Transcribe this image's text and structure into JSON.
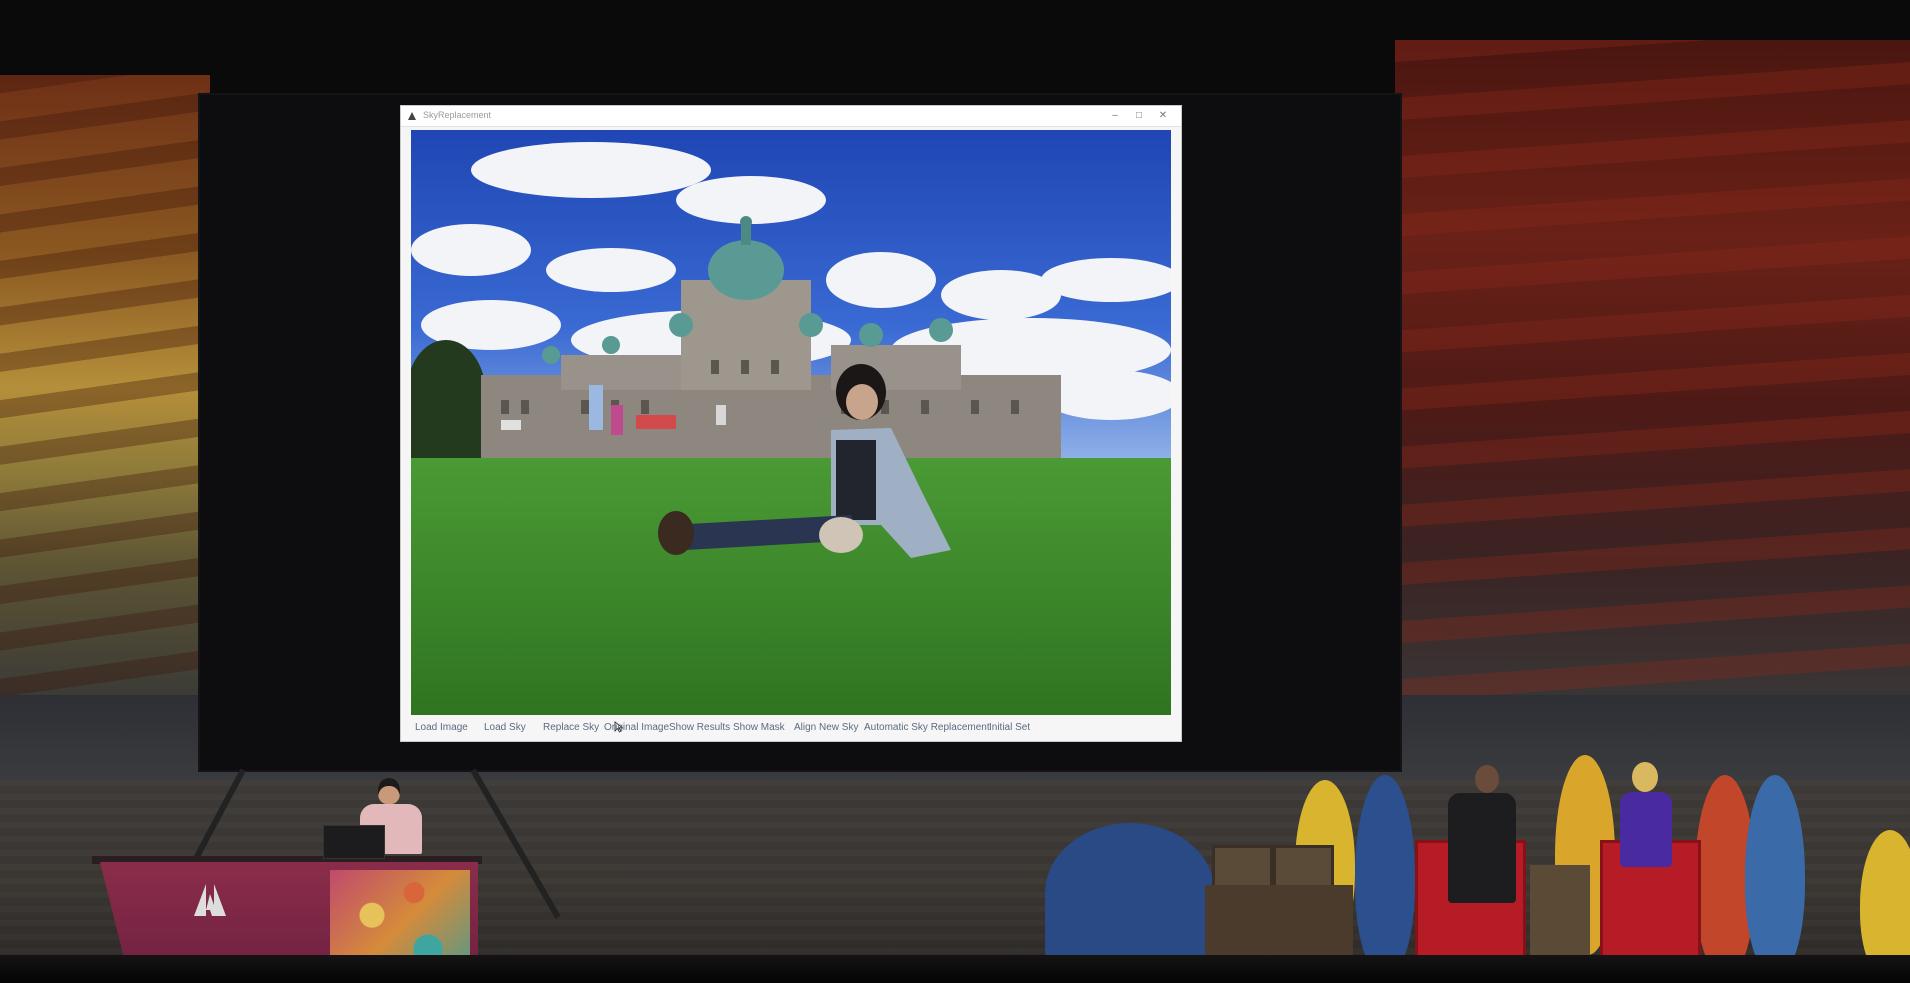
{
  "window": {
    "title": "SkyReplacement",
    "controls": [
      "–",
      "□",
      "✕"
    ]
  },
  "toolbar": {
    "buttons": [
      "Load Image",
      "Load Sky",
      "Replace Sky",
      "Original Image",
      "Show Results",
      "Show Mask",
      "Align New Sky",
      "Automatic Sky Replacement",
      "Initial Set"
    ]
  },
  "photo": {
    "subject": "photo-of-woman-on-lawn-before-domed-building",
    "sky_color": "#2d55c2",
    "grass_color": "#3f8b2f"
  },
  "stage": {
    "podium_logo": "Adobe",
    "podium_color": "#8a2d4a",
    "accent_colors": [
      "#b51c25",
      "#2a4a85",
      "#d9a52a"
    ]
  },
  "icons": {
    "app": "app-logo-icon",
    "cursor": "mouse-pointer-icon",
    "adobe": "adobe-logo-icon"
  }
}
